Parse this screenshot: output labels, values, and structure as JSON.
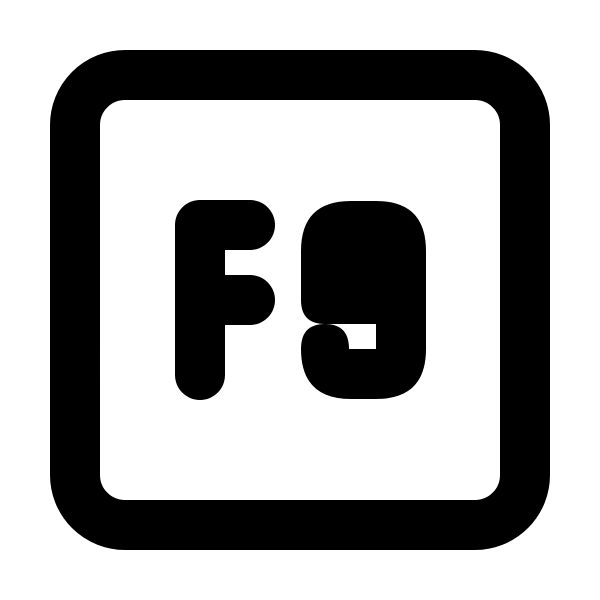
{
  "icon": {
    "name": "function-key-f9-icon",
    "key_label": "F9",
    "stroke_color": "#000000",
    "background_color": "#ffffff"
  }
}
